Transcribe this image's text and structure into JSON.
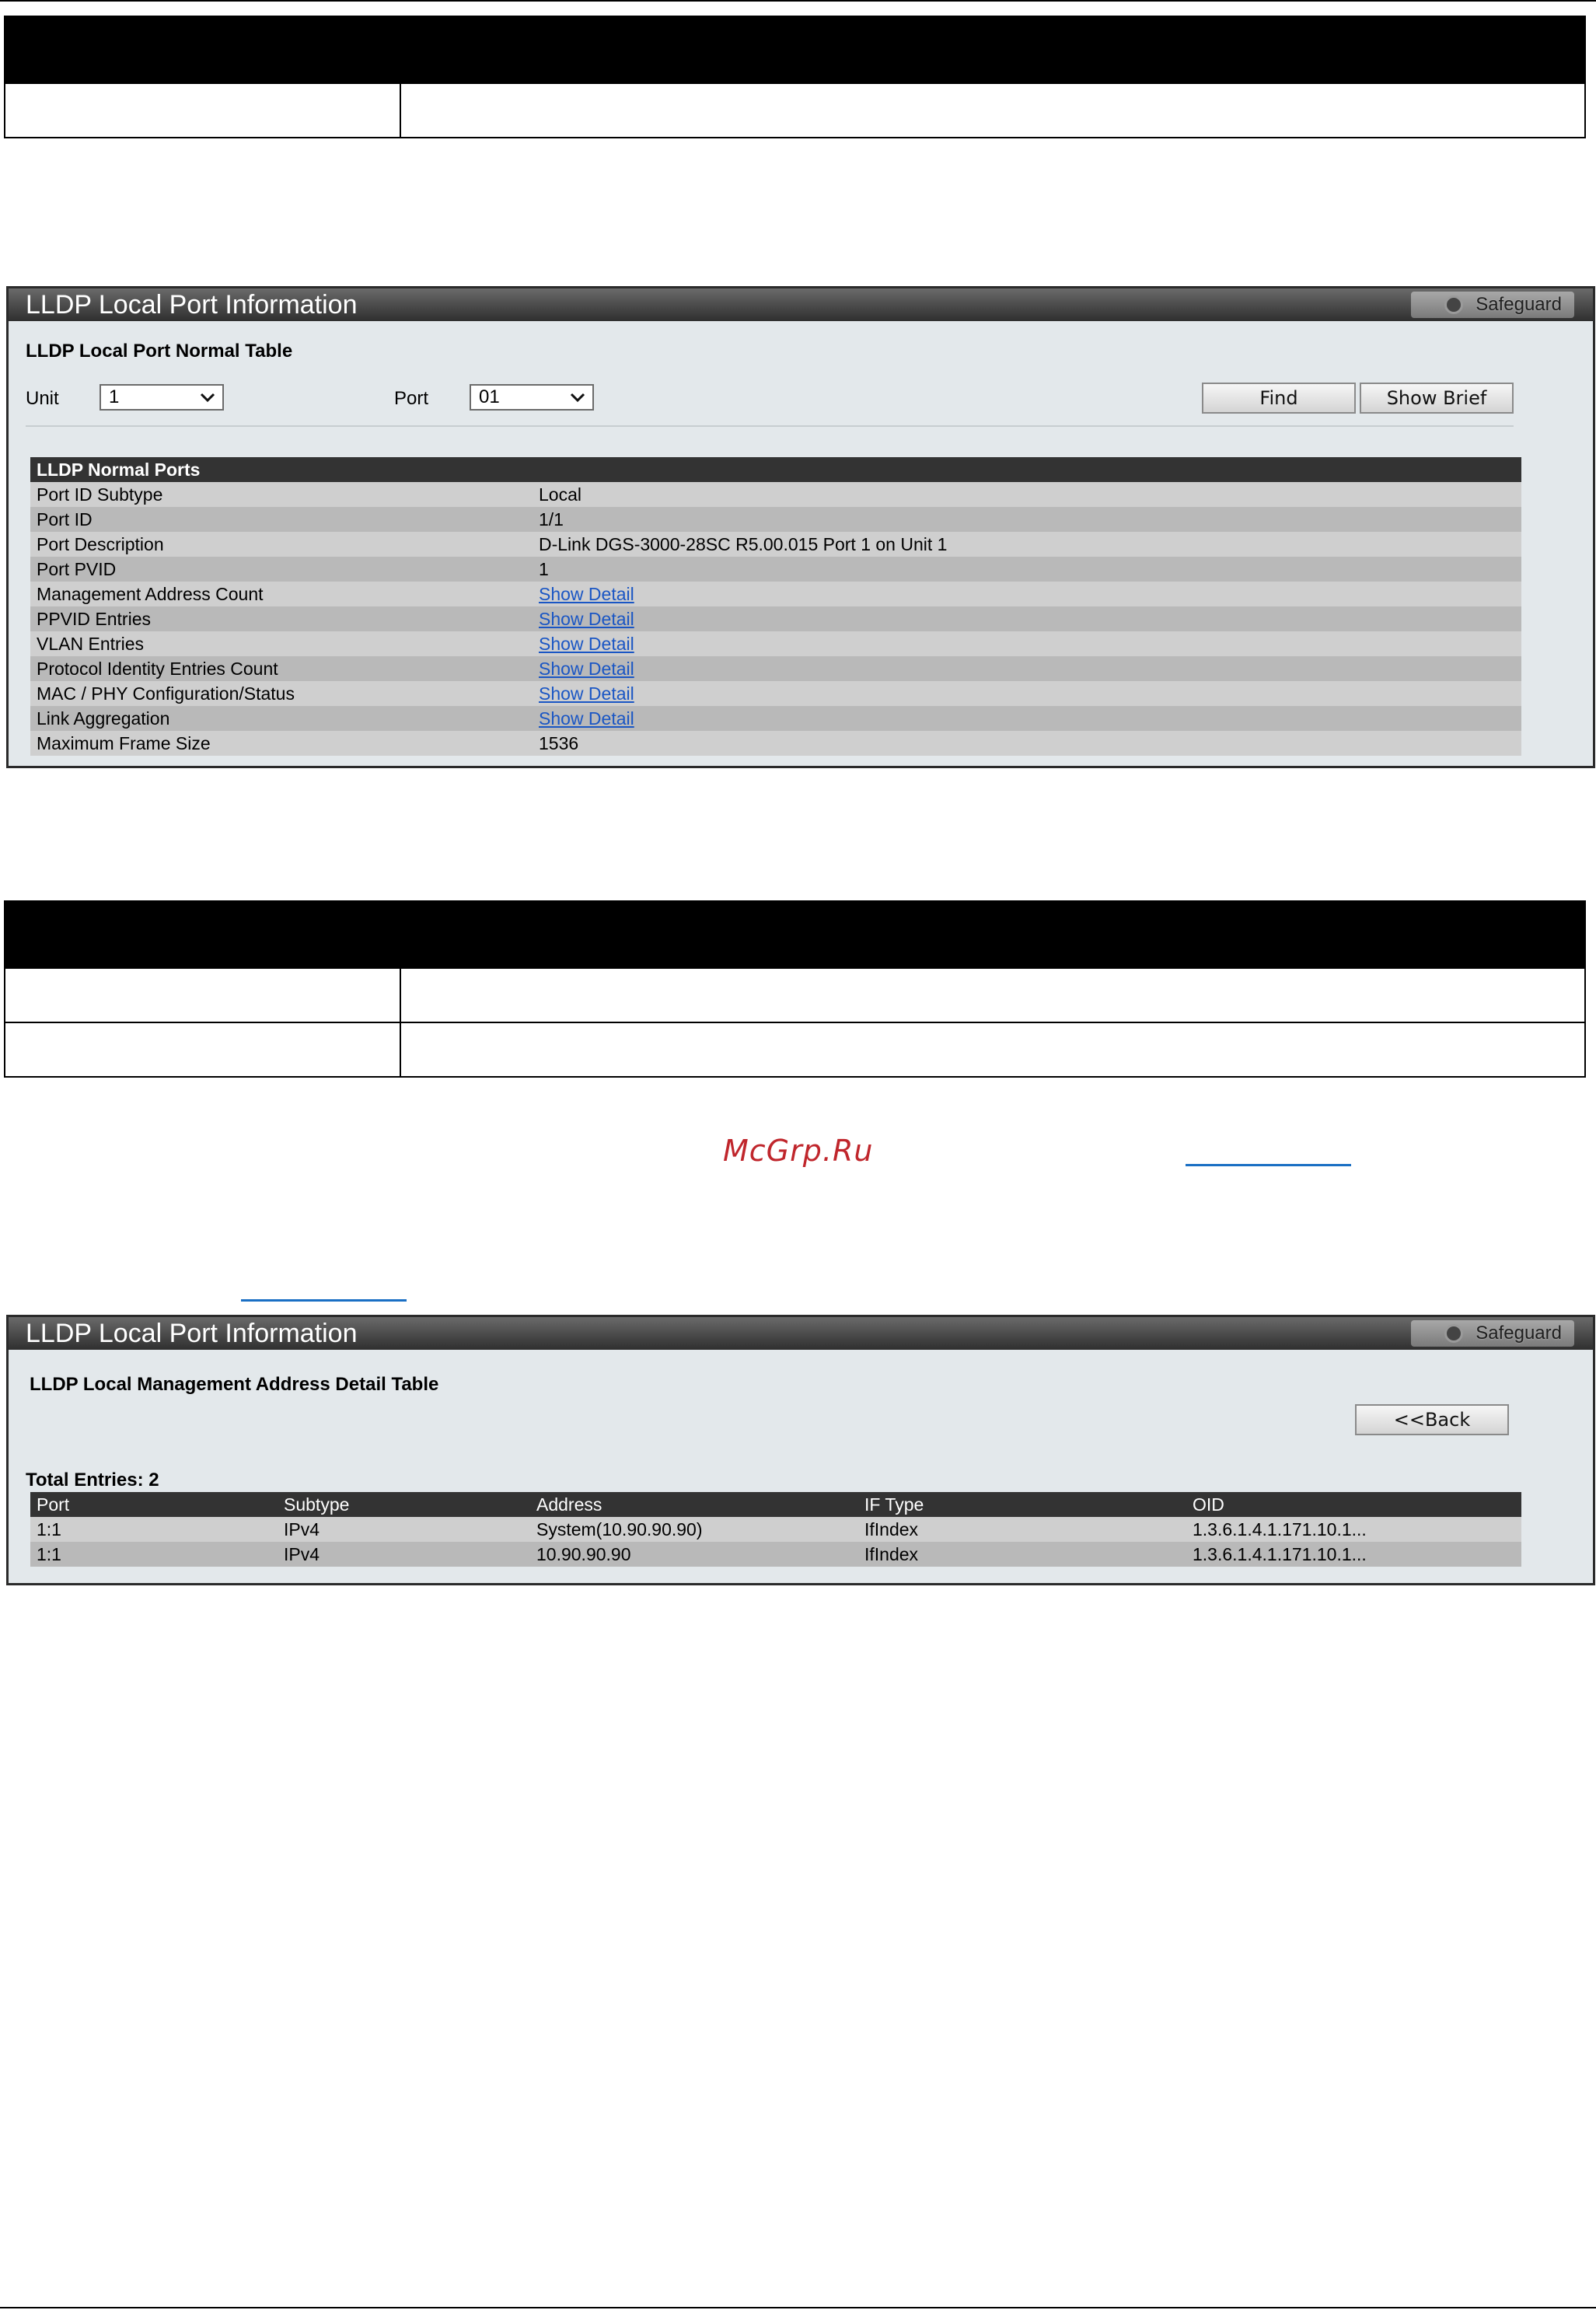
{
  "panel1": {
    "title": "LLDP Local Port Information",
    "safeguard": "Safeguard",
    "subtitle": "LLDP Local Port Normal Table",
    "unit_label": "Unit",
    "unit_value": "1",
    "port_label": "Port",
    "port_value": "01",
    "find_button": "Find",
    "show_brief_button": "Show Brief",
    "table_header": "LLDP Normal Ports",
    "rows": [
      {
        "name": "Port ID Subtype",
        "value": "Local",
        "link": false
      },
      {
        "name": "Port ID",
        "value": "1/1",
        "link": false
      },
      {
        "name": "Port Description",
        "value": "D-Link DGS-3000-28SC R5.00.015 Port 1 on Unit 1",
        "link": false
      },
      {
        "name": "Port PVID",
        "value": "1",
        "link": false
      },
      {
        "name": "Management Address Count",
        "value": "Show Detail",
        "link": true
      },
      {
        "name": "PPVID Entries",
        "value": "Show Detail",
        "link": true
      },
      {
        "name": "VLAN Entries",
        "value": "Show Detail",
        "link": true
      },
      {
        "name": "Protocol Identity Entries Count",
        "value": "Show Detail",
        "link": true
      },
      {
        "name": "MAC / PHY Configuration/Status",
        "value": "Show Detail",
        "link": true
      },
      {
        "name": "Link Aggregation",
        "value": "Show Detail",
        "link": true
      },
      {
        "name": "Maximum Frame Size",
        "value": "1536",
        "link": false
      }
    ]
  },
  "watermark": "McGrp.Ru",
  "panel2": {
    "title": "LLDP Local Port Information",
    "safeguard": "Safeguard",
    "subtitle": "LLDP Local Management Address Detail Table",
    "back_button": "<<Back",
    "total_entries": "Total Entries: 2",
    "columns": [
      "Port",
      "Subtype",
      "Address",
      "IF Type",
      "OID"
    ],
    "rows": [
      [
        "1:1",
        "IPv4",
        "System(10.90.90.90)",
        "IfIndex",
        "1.3.6.1.4.1.171.10.1..."
      ],
      [
        "1:1",
        "IPv4",
        "10.90.90.90",
        "IfIndex",
        "1.3.6.1.4.1.171.10.1..."
      ]
    ]
  }
}
